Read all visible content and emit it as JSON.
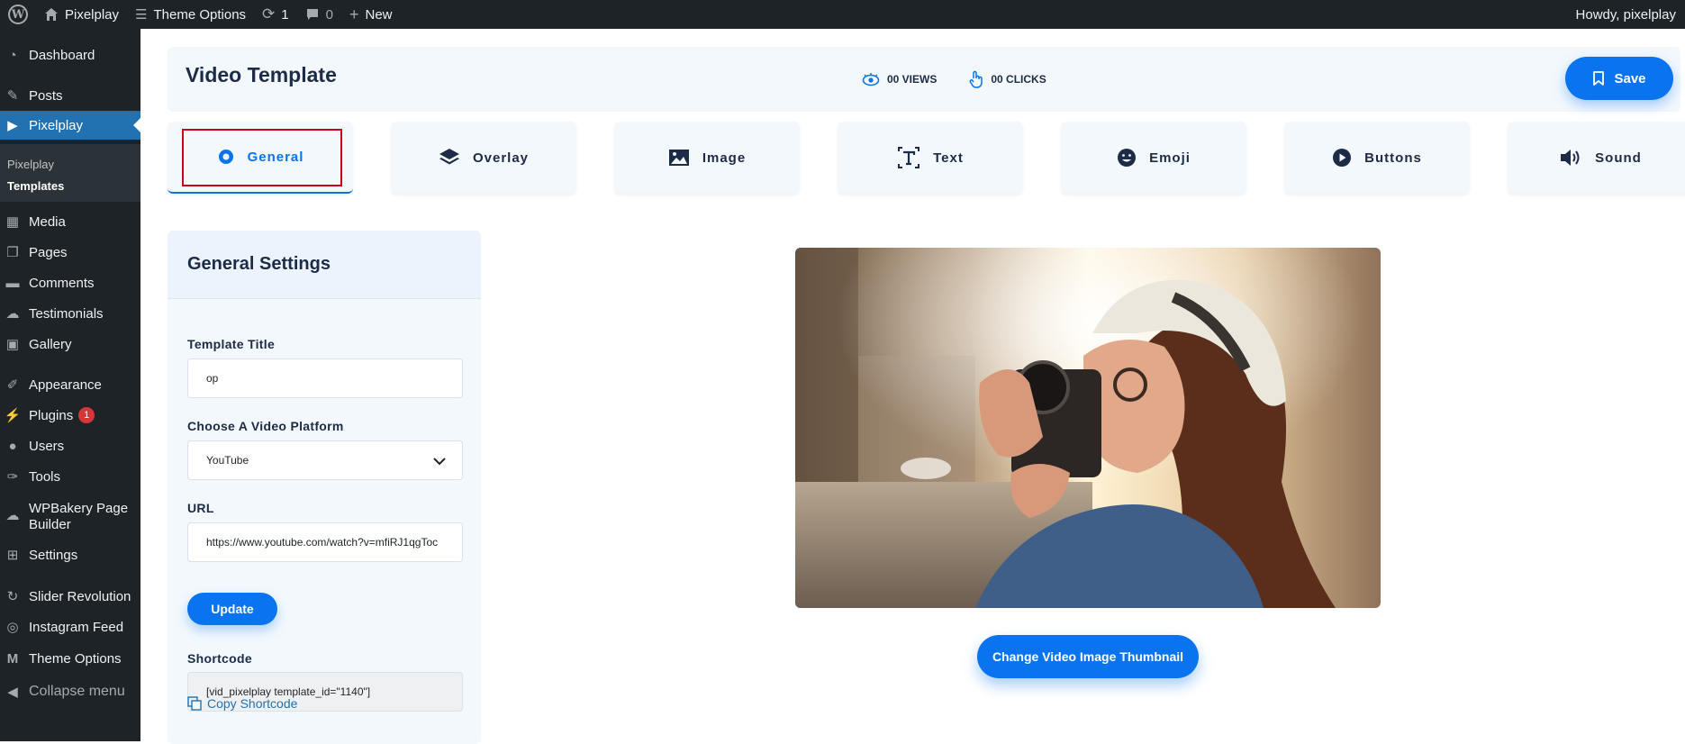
{
  "adminbar": {
    "site_name": "Pixelplay",
    "theme_options": "Theme Options",
    "updates_count": "1",
    "comments_count": "0",
    "new_label": "New",
    "howdy": "Howdy, pixelplay"
  },
  "sidebar": {
    "items": {
      "dashboard": "Dashboard",
      "posts": "Posts",
      "pixelplay": "Pixelplay",
      "media": "Media",
      "pages": "Pages",
      "comments": "Comments",
      "testimonials": "Testimonials",
      "gallery": "Gallery",
      "appearance": "Appearance",
      "plugins": "Plugins",
      "plugins_badge": "1",
      "users": "Users",
      "tools": "Tools",
      "wpbakery_line1": "WPBakery Page",
      "wpbakery_line2": "Builder",
      "settings": "Settings",
      "slider_revolution": "Slider Revolution",
      "instagram_feed": "Instagram Feed",
      "theme_options": "Theme Options",
      "collapse": "Collapse menu"
    },
    "submenu": {
      "pixelplay": "Pixelplay",
      "templates": "Templates"
    }
  },
  "header": {
    "title": "Video Template",
    "views": "00 VIEWS",
    "clicks": "00 CLICKS",
    "save_label": "Save"
  },
  "tabs": [
    {
      "label": "General",
      "icon": "gear-icon"
    },
    {
      "label": "Overlay",
      "icon": "layers-icon"
    },
    {
      "label": "Image",
      "icon": "image-icon"
    },
    {
      "label": "Text",
      "icon": "text-icon"
    },
    {
      "label": "Emoji",
      "icon": "emoji-icon"
    },
    {
      "label": "Buttons",
      "icon": "play-icon"
    },
    {
      "label": "Sound",
      "icon": "speaker-icon"
    }
  ],
  "settings": {
    "heading": "General Settings",
    "template_title_label": "Template Title",
    "template_title_value": "op",
    "platform_label": "Choose A Video Platform",
    "platform_value": "YouTube",
    "url_label": "URL",
    "url_value": "https://www.youtube.com/watch?v=mfiRJ1qgToc",
    "update_label": "Update",
    "shortcode_label": "Shortcode",
    "shortcode_value": "[vid_pixelplay template_id=\"1140\"]",
    "copy_label": "Copy Shortcode"
  },
  "preview": {
    "change_thumbnail_label": "Change Video Image Thumbnail"
  },
  "colors": {
    "accent": "#0a74f0",
    "admin_dark": "#1d2327",
    "admin_blue": "#2271b1",
    "highlight_red": "#d0021b"
  }
}
